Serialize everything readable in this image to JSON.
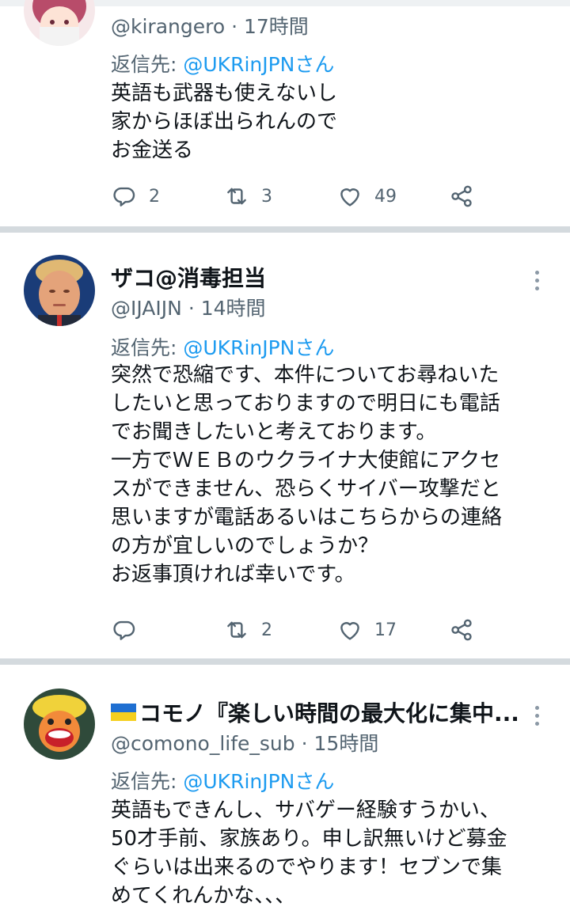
{
  "tweets": [
    {
      "handle": "@kirangero",
      "time": "17時間",
      "reply_prefix": "返信先: ",
      "reply_mention": "@UKRinJPNさん",
      "lines": [
        "英語も武器も使えないし",
        "家からほぼ出られんので",
        "お金送る"
      ],
      "replies": "2",
      "retweets": "3",
      "likes": "49"
    },
    {
      "name": "ザコ@消毒担当",
      "handle": "@IJAIJN",
      "time": "14時間",
      "reply_prefix": "返信先: ",
      "reply_mention": "@UKRinJPNさん",
      "lines": [
        "突然で恐縮です、本件についてお尋ねいた",
        "したいと思っておりますので明日にも電話",
        "でお聞きしたいと考えております。",
        "一方でＷＥＢのウクライナ大使館にアクセ",
        "スができません、恐らくサイバー攻撃だと",
        "思いますが電話あるいはこちらからの連絡",
        "の方が宜しいのでしょうか？",
        "お返事頂ければ幸いです。"
      ],
      "replies": "",
      "retweets": "2",
      "likes": "17"
    },
    {
      "name": "コモノ『楽しい時間の最大化に集中...",
      "handle": "@comono_life_sub",
      "time": "15時間",
      "reply_prefix": "返信先: ",
      "reply_mention": "@UKRinJPNさん",
      "lines": [
        "英語もできんし、サバゲー経験すうかい、",
        "50才手前、家族あり。申し訳無いけど募金",
        "ぐらいは出来るのでやります！セブンで集",
        "めてくれんかな、、、"
      ]
    }
  ],
  "separator": "·",
  "colors": {
    "accent": "#1d9bf0",
    "muted": "#536471",
    "separator": "#d4dade"
  },
  "icons": [
    "reply-icon",
    "retweet-icon",
    "like-icon",
    "share-icon",
    "more-icon",
    "ukraine-flag-icon"
  ]
}
